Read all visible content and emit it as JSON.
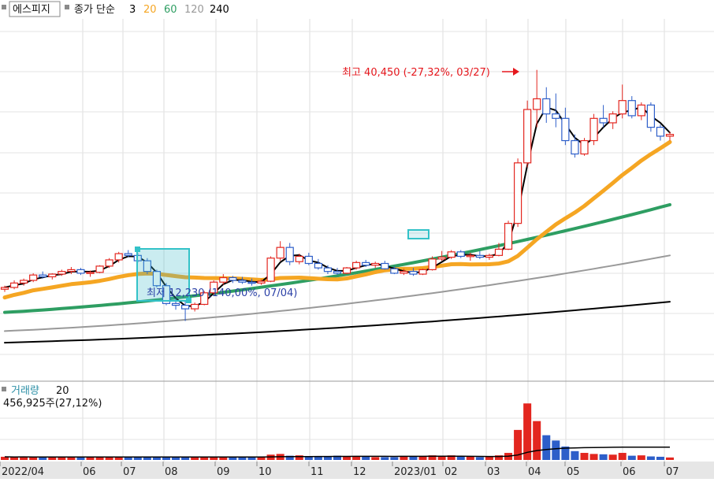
{
  "legend_price": {
    "name": "에스피지",
    "type_label": "종가 단순",
    "periods": [
      "3",
      "20",
      "60",
      "120",
      "240"
    ],
    "colors": [
      "#000000",
      "#f5a623",
      "#2e9e62",
      "#999999",
      "#000000"
    ]
  },
  "legend_volume": {
    "label": "거래량",
    "period": "20",
    "value_text": "456,925주(27,12%)"
  },
  "annotations": {
    "high_text": "최고 40,450 (-27,32%, 03/27)",
    "low_text": "최저 12,230 (140,00%, 07/04)"
  },
  "chart_data": {
    "type": "candlestick",
    "x_tick_labels": [
      "2022/04",
      "06",
      "07",
      "08",
      "09",
      "10",
      "11",
      "12",
      "2023/01",
      "02",
      "03",
      "04",
      "05",
      "06",
      "07"
    ],
    "ylim": [
      6000,
      46000
    ],
    "grid": true,
    "candles_approx": [
      [
        15800,
        16200,
        15500,
        16000
      ],
      [
        16000,
        16800,
        15800,
        16500
      ],
      [
        16500,
        17000,
        16200,
        16800
      ],
      [
        16800,
        17600,
        16600,
        17400
      ],
      [
        17400,
        17800,
        17000,
        17200
      ],
      [
        17200,
        17600,
        16900,
        17500
      ],
      [
        17500,
        18000,
        17300,
        17800
      ],
      [
        17800,
        18300,
        17500,
        18000
      ],
      [
        18000,
        18200,
        17400,
        17600
      ],
      [
        17600,
        17900,
        17200,
        17700
      ],
      [
        17700,
        18500,
        17600,
        18400
      ],
      [
        18400,
        19300,
        18200,
        19100
      ],
      [
        19100,
        20000,
        18800,
        19800
      ],
      [
        19800,
        20200,
        19400,
        19600
      ],
      [
        19600,
        19900,
        18800,
        19000
      ],
      [
        19000,
        19300,
        17500,
        17800
      ],
      [
        17800,
        18000,
        16000,
        16200
      ],
      [
        16200,
        16500,
        14000,
        14200
      ],
      [
        14200,
        14800,
        13500,
        14000
      ],
      [
        14000,
        14500,
        12230,
        13600
      ],
      [
        13600,
        14300,
        13300,
        14100
      ],
      [
        14100,
        15600,
        14000,
        15400
      ],
      [
        15400,
        16800,
        15200,
        16600
      ],
      [
        16600,
        17500,
        16300,
        17100
      ],
      [
        17100,
        17300,
        16500,
        16800
      ],
      [
        16800,
        17200,
        16400,
        16600
      ],
      [
        16600,
        17000,
        16200,
        16500
      ],
      [
        16500,
        16900,
        16300,
        16700
      ],
      [
        16700,
        19500,
        16600,
        19300
      ],
      [
        19300,
        21200,
        19000,
        20500
      ],
      [
        20500,
        21000,
        18500,
        18900
      ],
      [
        18900,
        19800,
        18600,
        19500
      ],
      [
        19500,
        19900,
        18500,
        18700
      ],
      [
        18700,
        19200,
        18000,
        18200
      ],
      [
        18200,
        18500,
        17500,
        17800
      ],
      [
        17800,
        18200,
        17400,
        17600
      ],
      [
        17600,
        18300,
        17500,
        18200
      ],
      [
        18200,
        19000,
        18000,
        18800
      ],
      [
        18800,
        19100,
        18300,
        18500
      ],
      [
        18500,
        18900,
        18200,
        18700
      ],
      [
        18700,
        19000,
        18000,
        18100
      ],
      [
        18100,
        18400,
        17500,
        17600
      ],
      [
        17600,
        18100,
        17400,
        17800
      ],
      [
        17800,
        18200,
        17300,
        17500
      ],
      [
        17500,
        18100,
        17400,
        18000
      ],
      [
        18000,
        19500,
        17900,
        19200
      ],
      [
        19200,
        20100,
        19000,
        19400
      ],
      [
        19400,
        20200,
        19200,
        20000
      ],
      [
        20000,
        20200,
        19300,
        19500
      ],
      [
        19500,
        19900,
        19000,
        19600
      ],
      [
        19600,
        20100,
        19200,
        19400
      ],
      [
        19400,
        19800,
        19100,
        19600
      ],
      [
        19600,
        21000,
        19500,
        20300
      ],
      [
        20300,
        23500,
        20200,
        23200
      ],
      [
        23200,
        30500,
        22800,
        30000
      ],
      [
        30000,
        37000,
        29500,
        36000
      ],
      [
        36000,
        40450,
        34000,
        37200
      ],
      [
        37200,
        38500,
        34500,
        35500
      ],
      [
        35500,
        37800,
        34000,
        35000
      ],
      [
        35000,
        36200,
        32000,
        32500
      ],
      [
        32500,
        33200,
        30600,
        31000
      ],
      [
        31000,
        32800,
        30800,
        32500
      ],
      [
        32500,
        35500,
        32000,
        35000
      ],
      [
        35000,
        36500,
        34000,
        34500
      ],
      [
        34500,
        35800,
        33800,
        35500
      ],
      [
        35500,
        38800,
        35000,
        37000
      ],
      [
        37000,
        37500,
        35000,
        35300
      ],
      [
        35300,
        36800,
        34800,
        36500
      ],
      [
        36500,
        36800,
        33500,
        34000
      ],
      [
        34000,
        34300,
        32500,
        33000
      ],
      [
        33000,
        33500,
        32500,
        33200
      ]
    ],
    "volume_approx": [
      0.9,
      0.8,
      0.9,
      0.8,
      0.7,
      0.8,
      1.0,
      0.8,
      0.7,
      0.8,
      0.8,
      0.9,
      0.8,
      0.8,
      0.9,
      0.8,
      0.8,
      0.7,
      0.8,
      0.9,
      0.9,
      1.0,
      0.8,
      0.9,
      0.8,
      0.8,
      0.8,
      0.9,
      1.5,
      1.7,
      1.2,
      1.3,
      1.0,
      1.0,
      1.0,
      1.2,
      1.0,
      1.0,
      0.9,
      0.8,
      0.8,
      0.8,
      0.9,
      0.9,
      0.9,
      1.3,
      1.1,
      1.3,
      1.0,
      0.9,
      0.8,
      0.9,
      1.3,
      2.0,
      8.5,
      16.0,
      11.0,
      7.0,
      5.5,
      3.8,
      2.5,
      2.0,
      1.7,
      1.6,
      1.5,
      2.0,
      1.2,
      1.3,
      1.0,
      0.9,
      0.7
    ]
  }
}
